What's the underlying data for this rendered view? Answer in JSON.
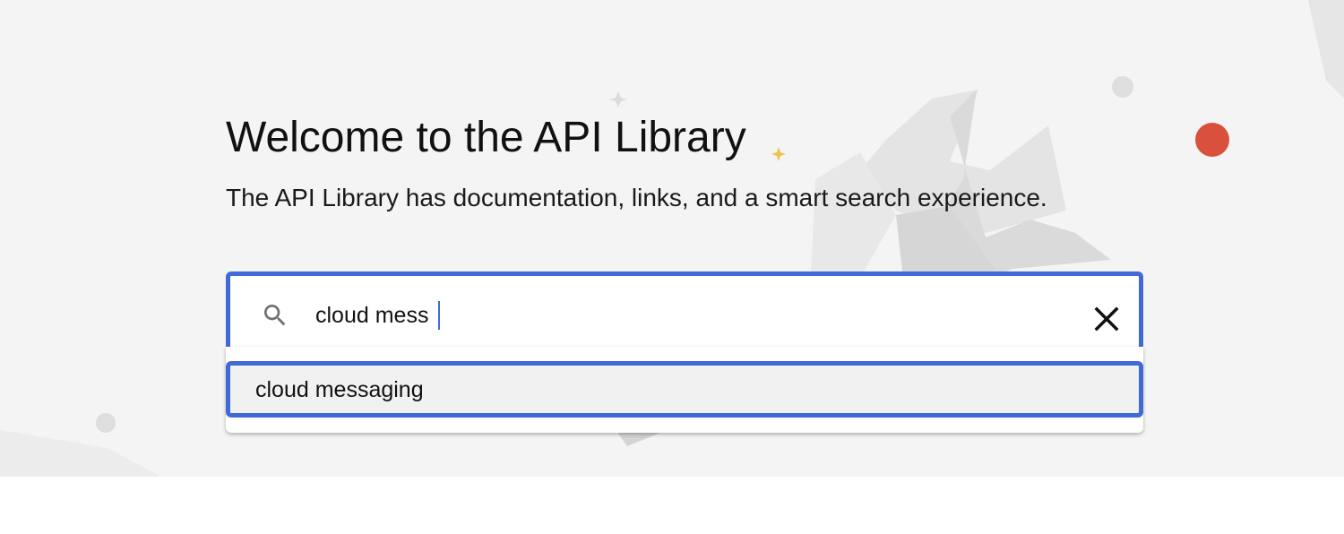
{
  "hero": {
    "title": "Welcome to the API Library",
    "subtitle": "The API Library has documentation, links, and a smart search experience."
  },
  "search": {
    "value": "cloud mess",
    "search_icon": "search-icon",
    "clear_icon": "close-icon"
  },
  "suggestions": [
    {
      "label": "cloud messaging"
    }
  ],
  "colors": {
    "accent": "#3f6ad8",
    "hero_background": "#f4f4f4",
    "decor_red": "#d9503d",
    "decor_yellow": "#f1c24a"
  }
}
